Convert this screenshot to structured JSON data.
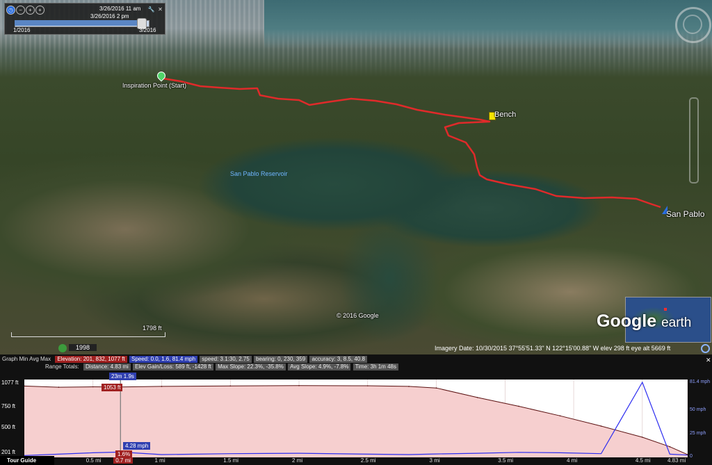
{
  "time_slider": {
    "date_top": "3/26/2016  11 am",
    "date_bottom": "3/26/2016  2 pm",
    "range_start": "1/2016",
    "range_end": "3/2016"
  },
  "map": {
    "labels": {
      "start": "Inspiration Point  (Start)",
      "bench": "Bench",
      "san_pablo": "San Pablo",
      "reservoir": "San Pablo Reservoir",
      "copyright": "© 2016 Google",
      "scale": "1798 ft"
    },
    "logo": {
      "google": "Google",
      "earth": "earth"
    },
    "historical_year": "1998",
    "status": "Imagery Date: 10/30/2015     37°55'51.33\" N  122°15'00.88\" W  elev   298 ft    eye alt   5669 ft",
    "trail_color": "#e02a2a"
  },
  "graph": {
    "stats_row1": {
      "graph": "Graph  Min  Avg  Max",
      "elevation": "Elevation: 201, 832, 1077 ft",
      "speed": "Speed: 0.0, 1.6, 81.4 mph",
      "speed2": "speed: 3.1:30, 2.75",
      "bearing": "bearing: 0, 230, 359",
      "accuracy": "accuracy: 3, 8.5, 40.8"
    },
    "stats_row2": {
      "range_totals": "Range Totals:",
      "distance": "Distance: 4.83 mi",
      "elev_gain": "Elev Gain/Loss: 589 ft, -1428 ft",
      "max_slope": "Max Slope: 22.3%, -35.8%",
      "avg_slope": "Avg Slope: 4.9%, -7.8%",
      "time": "Time: 3h 1m 48s"
    },
    "y_left": [
      "1077 ft",
      "750 ft",
      "500 ft",
      "201 ft"
    ],
    "y_right": [
      "81.4 mph",
      "50 mph",
      "25 mph",
      "0"
    ],
    "x_labels": [
      "0.5 mi",
      "0.7 mi",
      "1 mi",
      "1.5 mi",
      "2 mi",
      "2.5 mi",
      "3 mi",
      "3.5 mi",
      "4 mi",
      "4.5 mi",
      "4.83 mi"
    ],
    "selected_x": "0.7 mi",
    "callouts": {
      "time": "23m 1.9s",
      "elevation": "1053 ft",
      "speed": "4.28 mph",
      "slope": "1.6%"
    },
    "tour_guide": "Tour Guide"
  },
  "chart_data": {
    "type": "area",
    "x": [
      0,
      0.25,
      0.5,
      0.7,
      1.0,
      1.5,
      2.0,
      2.5,
      2.8,
      3.0,
      3.3,
      3.6,
      3.9,
      4.2,
      4.5,
      4.7,
      4.83
    ],
    "series": [
      {
        "name": "Elevation",
        "values": [
          1065,
          1050,
          1055,
          1053,
          1060,
          1066,
          1070,
          1068,
          1060,
          1040,
          920,
          810,
          690,
          560,
          420,
          300,
          201
        ]
      },
      {
        "name": "Speed",
        "values": [
          0.5,
          2.0,
          3.5,
          4.28,
          1.5,
          2.5,
          3.0,
          2.0,
          1.5,
          2.2,
          3.0,
          4.0,
          3.5,
          2.5,
          81.4,
          2.0,
          1.0
        ]
      }
    ],
    "ylim": [
      201,
      1077
    ],
    "y2lim": [
      0,
      81.4
    ],
    "xlim": [
      0,
      4.83
    ],
    "selected": 0.7,
    "colors": {
      "elevation_fill": "#f6cfcf",
      "elevation_line": "#5a1010",
      "speed_line": "#2d2df0"
    }
  }
}
